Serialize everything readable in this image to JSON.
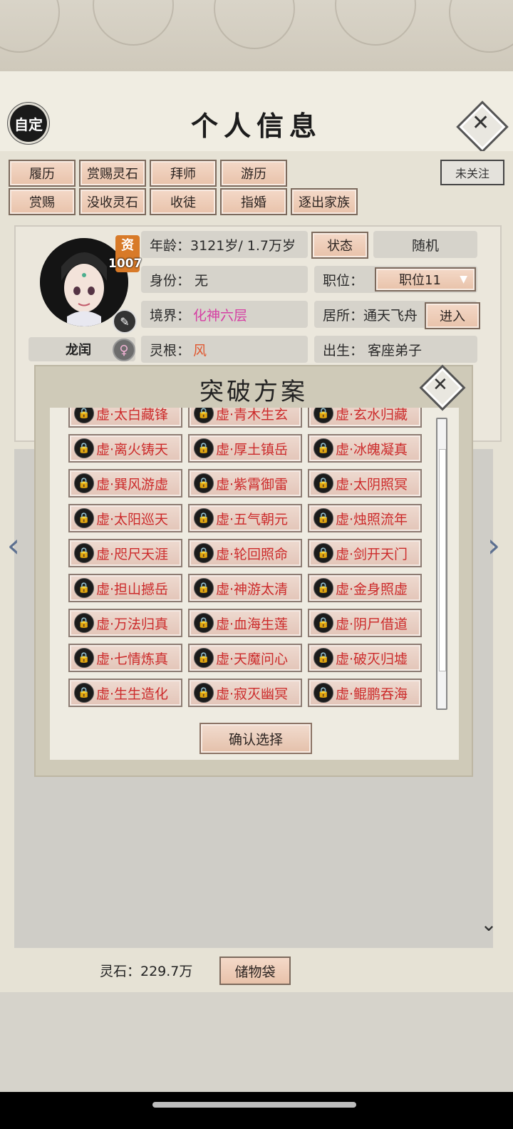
{
  "header": {
    "custom_label": "自定",
    "title": "个人信息",
    "close_icon": "close-icon"
  },
  "actions": {
    "row1": [
      "履历",
      "赏赐灵石",
      "拜师",
      "游历"
    ],
    "row2": [
      "赏赐",
      "没收灵石",
      "收徒",
      "指婚",
      "逐出家族"
    ],
    "follow": "未关注"
  },
  "profile": {
    "name": "龙闰",
    "aptitude_label": "资",
    "aptitude_value": "1007",
    "age": "年龄：3121岁/ 1.7万岁",
    "status_btn": "状态",
    "random_btn": "随机",
    "identity": "身份：  无",
    "position_label": "职位：",
    "position_value": "职位11",
    "realm_label": "境界：",
    "realm_value": "化神六层",
    "residence": "居所：通天飞舟",
    "enter_btn": "进入",
    "root_label": "灵根：",
    "root_value": "风",
    "birth": "出生：  客座弟子"
  },
  "modal": {
    "title": "突破方案",
    "confirm": "确认选择",
    "items": [
      [
        "虚·太白藏锋",
        "虚·青木生玄",
        "虚·玄水归藏"
      ],
      [
        "虚·离火铸天",
        "虚·厚土镇岳",
        "虚·冰魄凝真"
      ],
      [
        "虚·巽风游虚",
        "虚·紫霄御雷",
        "虚·太阴照冥"
      ],
      [
        "虚·太阳巡天",
        "虚·五气朝元",
        "虚·烛照流年"
      ],
      [
        "虚·咫尺天涯",
        "虚·轮回照命",
        "虚·剑开天门"
      ],
      [
        "虚·担山撼岳",
        "虚·神游太清",
        "虚·金身照虚"
      ],
      [
        "虚·万法归真",
        "虚·血海生莲",
        "虚·阴尸借道"
      ],
      [
        "虚·七情炼真",
        "虚·天魔问心",
        "虚·破灭归墟"
      ],
      [
        "虚·生生造化",
        "虚·寂灭幽冥",
        "虚·鲲鹏吞海"
      ]
    ]
  },
  "footer": {
    "spirit_stones": "灵石：229.7万",
    "storage": "储物袋"
  },
  "colors": {
    "accent_red": "#cc2b2b",
    "realm_pink": "#d63fa3",
    "button_peach": "#e8c2aa"
  }
}
